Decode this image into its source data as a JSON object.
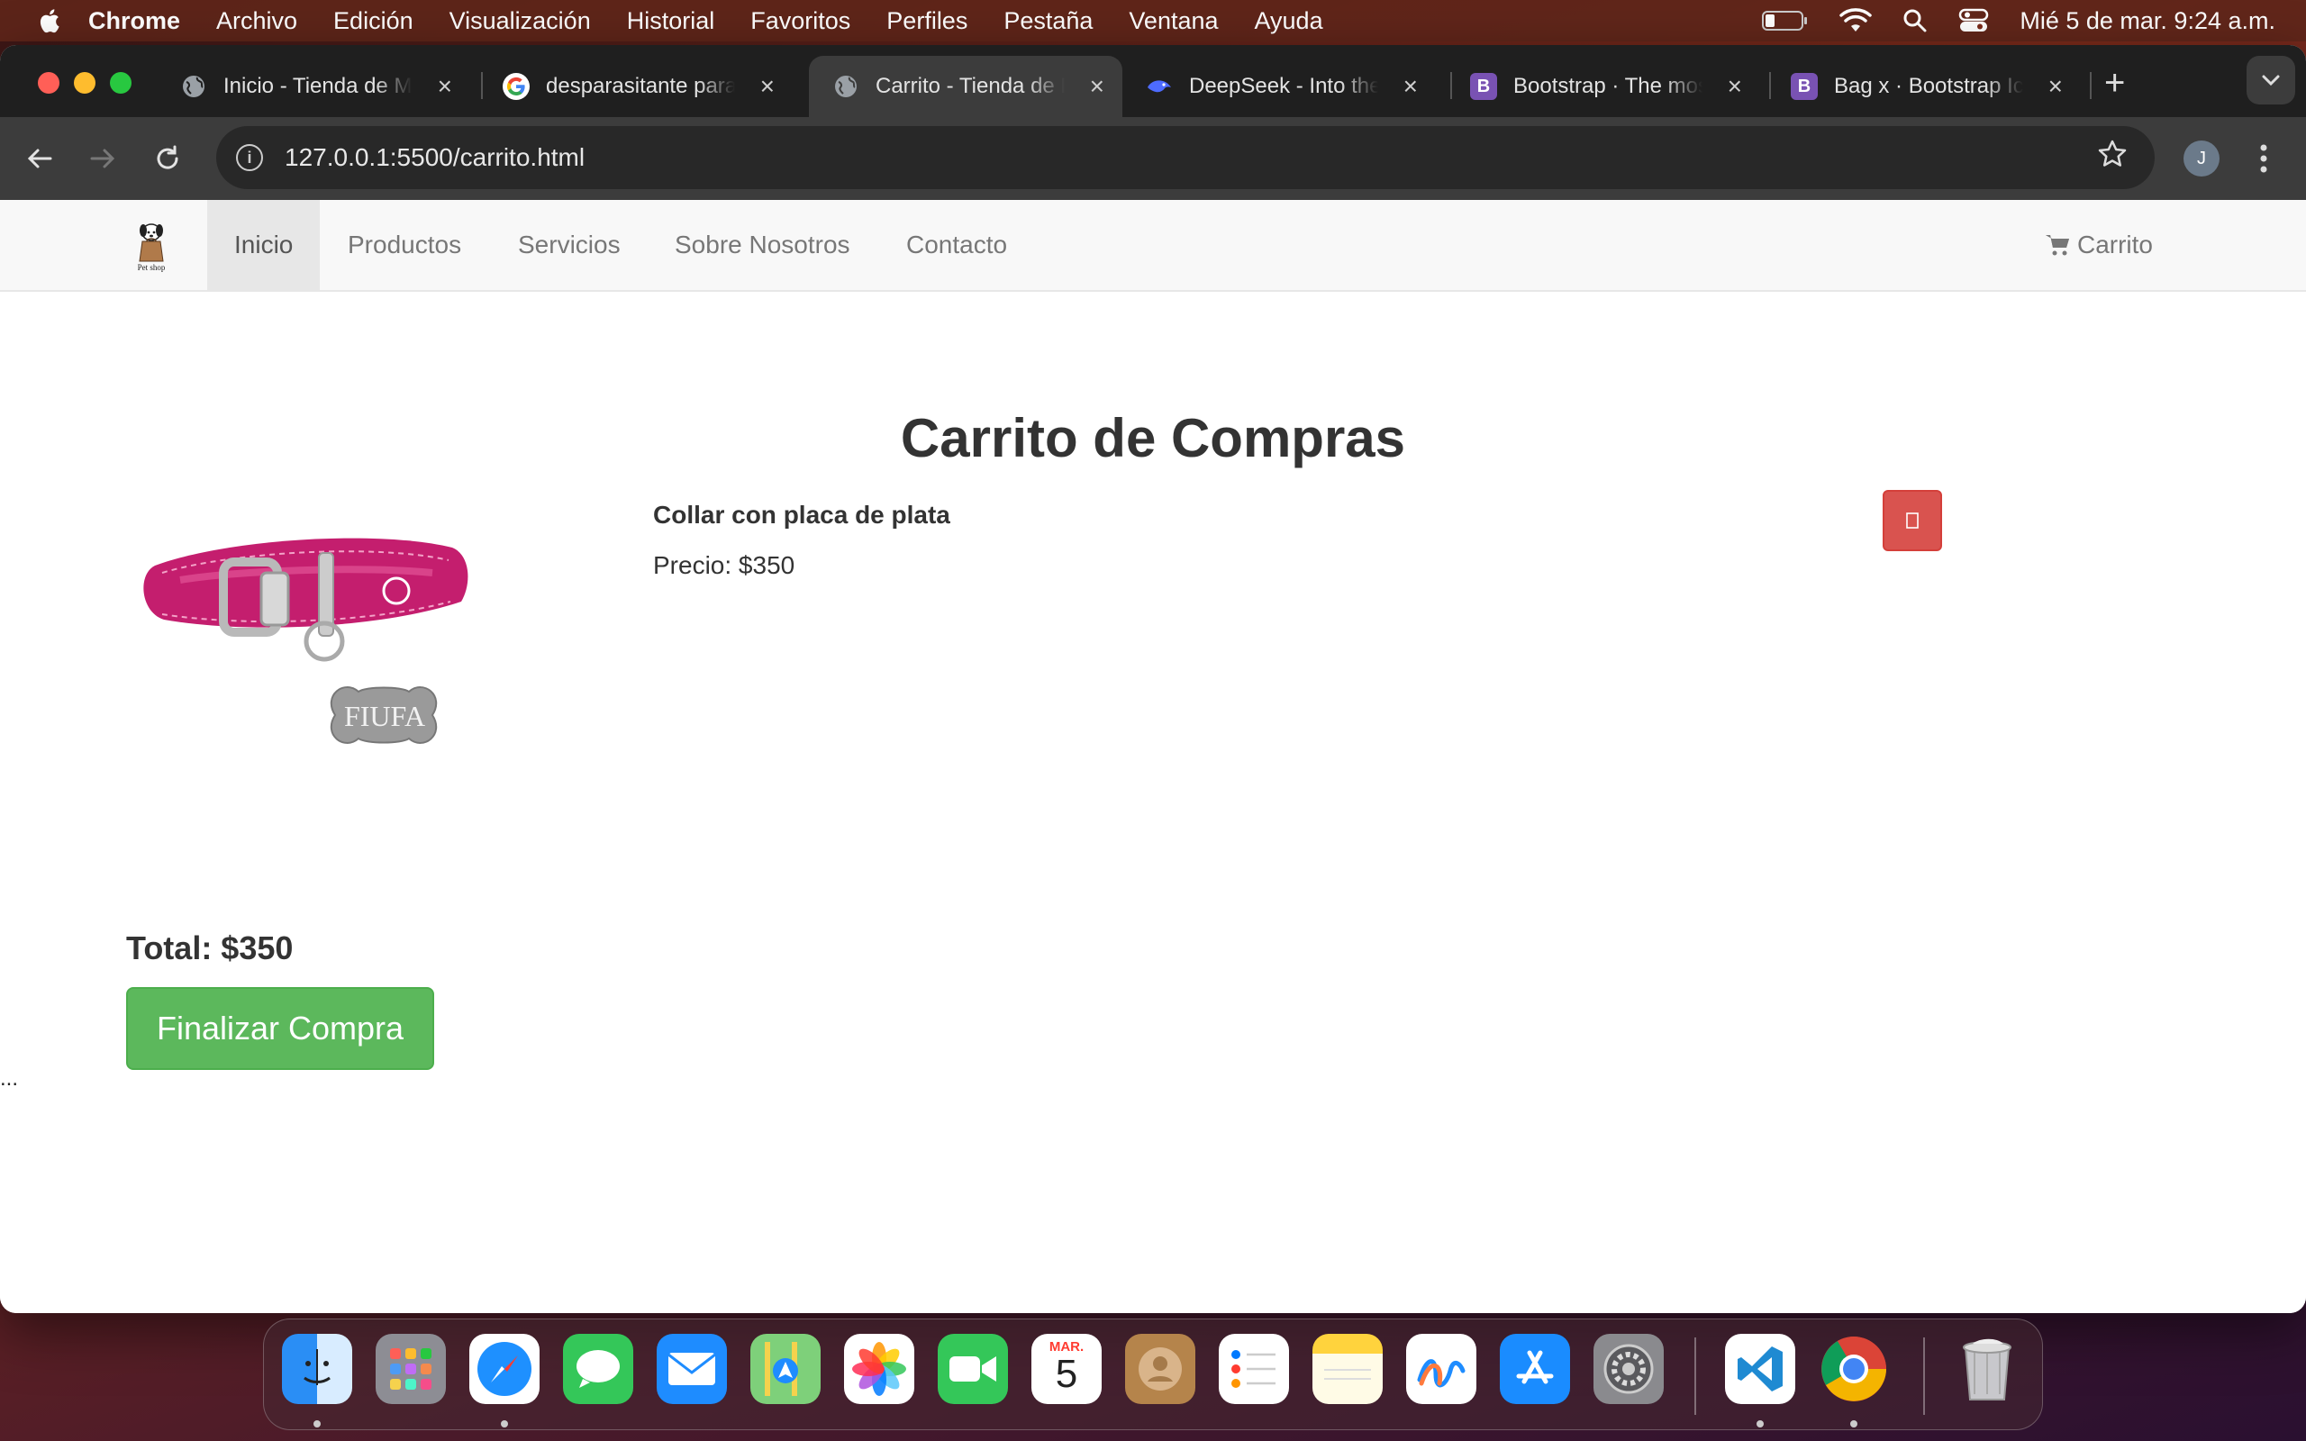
{
  "menubar": {
    "app_name": "Chrome",
    "items": [
      "Archivo",
      "Edición",
      "Visualización",
      "Historial",
      "Favoritos",
      "Perfiles",
      "Pestaña",
      "Ventana",
      "Ayuda"
    ],
    "clock": "Mié 5 de mar.  9:24 a.m."
  },
  "browser": {
    "tabs": [
      {
        "title": "Inicio - Tienda de Mascotas",
        "favicon": "globe-icon"
      },
      {
        "title": "desparasitante para perros",
        "favicon": "google-icon"
      },
      {
        "title": "Carrito - Tienda de Mascotas",
        "favicon": "globe-icon",
        "active": true
      },
      {
        "title": "DeepSeek - Into the Unknown",
        "favicon": "deepseek-icon"
      },
      {
        "title": "Bootstrap · The most popular",
        "favicon": "bootstrap-icon"
      },
      {
        "title": "Bag x · Bootstrap Icons",
        "favicon": "bootstrap-icon"
      }
    ],
    "url": "127.0.0.1:5500/carrito.html",
    "profile_initial": "J"
  },
  "page": {
    "brand_text": "Pet shop",
    "nav": [
      "Inicio",
      "Productos",
      "Servicios",
      "Sobre Nosotros",
      "Contacto"
    ],
    "active_nav": "Inicio",
    "cart_label": "Carrito",
    "heading": "Carrito de Compras",
    "cart_items": [
      {
        "name": "Collar con placa de plata",
        "price": "Precio: $350",
        "tag_text": "FIUFA"
      }
    ],
    "delete_icon": "trash-icon",
    "total": "Total: $350",
    "checkout_label": "Finalizar Compra",
    "trailing_text": "..."
  },
  "dock": {
    "calendar_month": "MAR.",
    "calendar_day": "5",
    "apps": [
      "finder",
      "launchpad",
      "safari",
      "messages",
      "mail",
      "maps",
      "photos",
      "facetime",
      "calendar",
      "contacts",
      "reminders",
      "notes",
      "freeform",
      "app-store",
      "system-settings",
      "vscode",
      "chrome",
      "trash"
    ]
  },
  "colors": {
    "danger": "#d9534f",
    "success": "#5cb85c",
    "navbar_bg": "#f8f8f8"
  }
}
